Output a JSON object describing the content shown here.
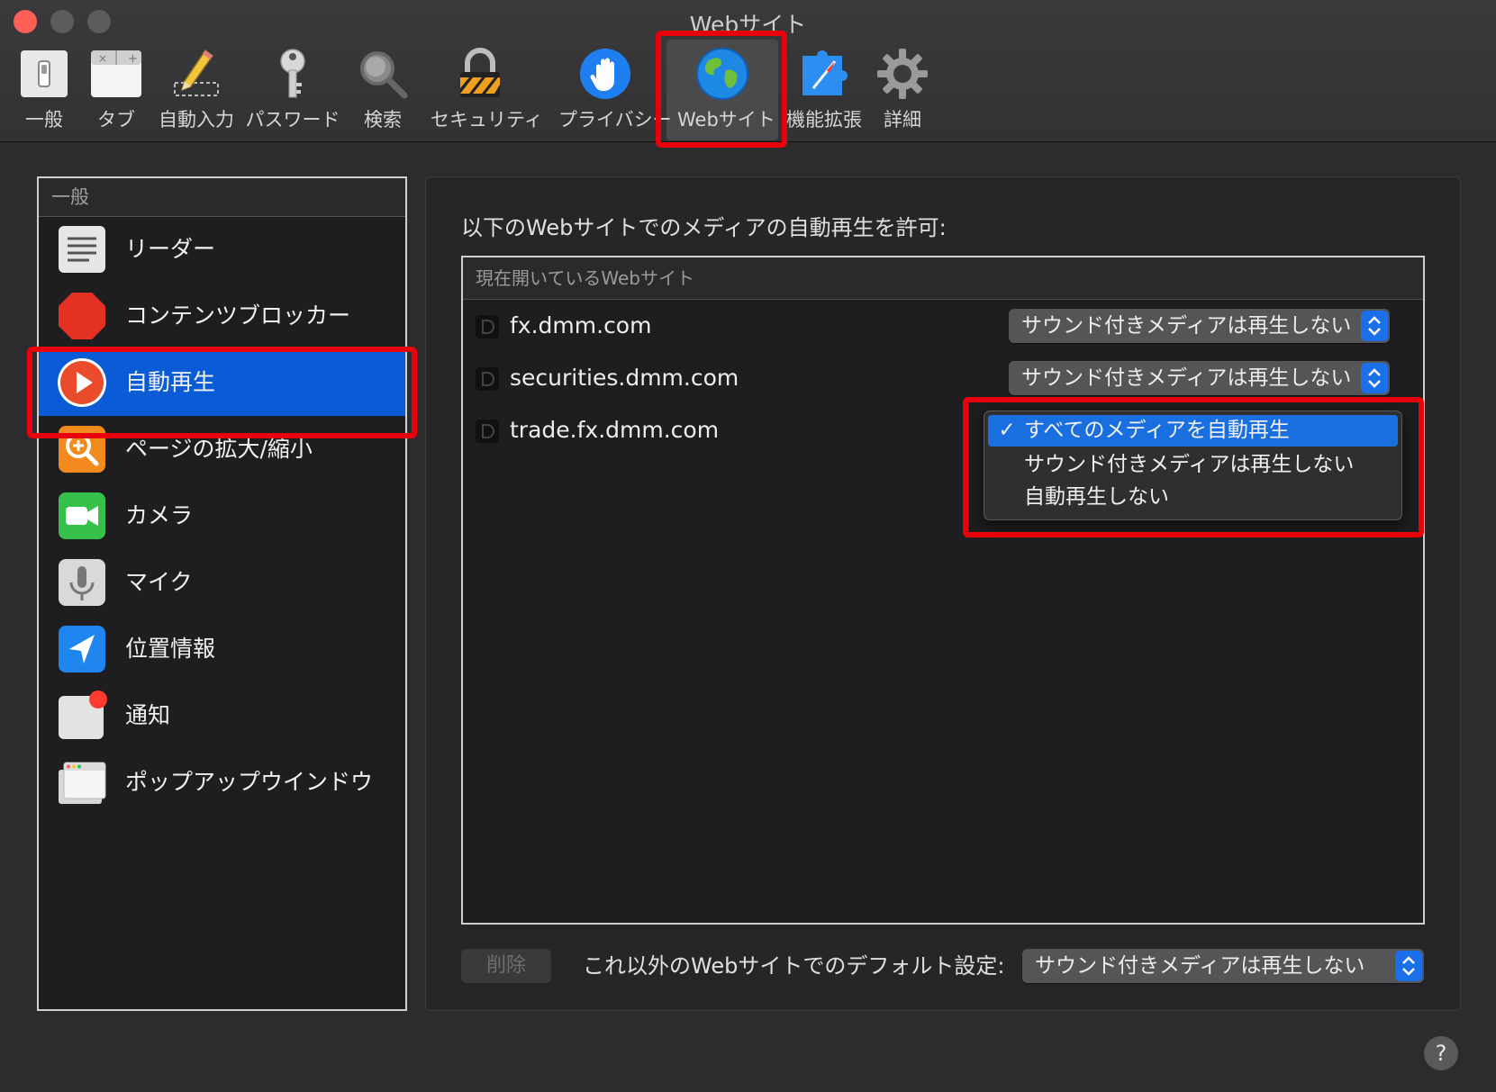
{
  "window": {
    "title": "Webサイト"
  },
  "toolbar": {
    "items": [
      {
        "label": "一般",
        "icon": "switch-icon"
      },
      {
        "label": "タブ",
        "icon": "tabs-icon"
      },
      {
        "label": "自動入力",
        "icon": "pencil-icon"
      },
      {
        "label": "パスワード",
        "icon": "key-icon"
      },
      {
        "label": "検索",
        "icon": "magnifier-icon"
      },
      {
        "label": "セキュリティ",
        "icon": "padlock-icon"
      },
      {
        "label": "プライバシー",
        "icon": "hand-icon"
      },
      {
        "label": "Webサイト",
        "icon": "globe-icon",
        "selected": true
      },
      {
        "label": "機能拡張",
        "icon": "puzzle-compass-icon"
      },
      {
        "label": "詳細",
        "icon": "gear-icon"
      }
    ]
  },
  "sidebar": {
    "header": "一般",
    "items": [
      {
        "label": "リーダー",
        "icon": "reader-icon"
      },
      {
        "label": "コンテンツブロッカー",
        "icon": "stop-sign-icon"
      },
      {
        "label": "自動再生",
        "icon": "play-icon",
        "selected": true
      },
      {
        "label": "ページの拡大/縮小",
        "icon": "zoom-icon"
      },
      {
        "label": "カメラ",
        "icon": "camera-icon"
      },
      {
        "label": "マイク",
        "icon": "microphone-icon"
      },
      {
        "label": "位置情報",
        "icon": "location-icon"
      },
      {
        "label": "通知",
        "icon": "notification-icon"
      },
      {
        "label": "ポップアップウインドウ",
        "icon": "popup-window-icon"
      }
    ]
  },
  "main": {
    "heading": "以下のWebサイトでのメディアの自動再生を許可:",
    "table_header": "現在開いているWebサイト",
    "sites": [
      {
        "domain": "fx.dmm.com",
        "setting": "サウンド付きメディアは再生しない"
      },
      {
        "domain": "securities.dmm.com",
        "setting": "サウンド付きメディアは再生しない"
      },
      {
        "domain": "trade.fx.dmm.com",
        "setting": "すべてのメディアを自動再生"
      }
    ],
    "menu_options": [
      {
        "check": "✓",
        "label": "すべてのメディアを自動再生"
      },
      {
        "check": "",
        "label": "サウンド付きメディアは再生しない"
      },
      {
        "check": "",
        "label": "自動再生しない"
      }
    ],
    "delete_label": "削除",
    "default_label": "これ以外のWebサイトでのデフォルト設定:",
    "default_value": "サウンド付きメディアは再生しない"
  },
  "help_label": "?",
  "colors": {
    "accent": "#0a5bd5",
    "annotation": "#e8000b"
  }
}
